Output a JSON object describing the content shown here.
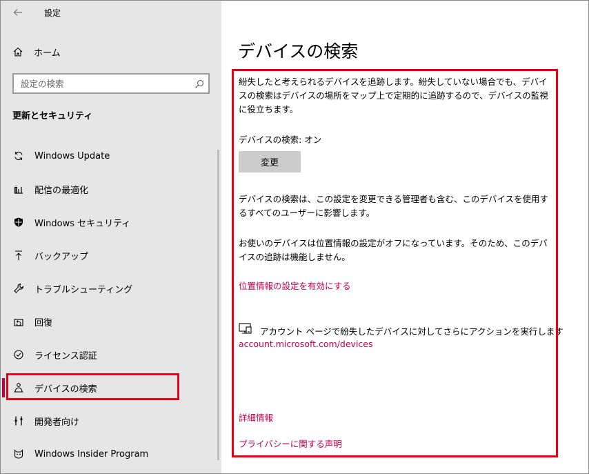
{
  "window": {
    "title": "設定"
  },
  "sidebar": {
    "home_label": "ホーム",
    "search_placeholder": "設定の検索",
    "section_title": "更新とセキュリティ",
    "items": [
      {
        "label": "Windows Update",
        "icon": "sync-icon"
      },
      {
        "label": "配信の最適化",
        "icon": "delivery-optimization-icon"
      },
      {
        "label": "Windows セキュリティ",
        "icon": "shield-icon"
      },
      {
        "label": "バックアップ",
        "icon": "backup-arrow-icon"
      },
      {
        "label": "トラブルシューティング",
        "icon": "wrench-icon"
      },
      {
        "label": "回復",
        "icon": "recovery-icon"
      },
      {
        "label": "ライセンス認証",
        "icon": "check-circle-icon"
      },
      {
        "label": "デバイスの検索",
        "icon": "person-location-icon",
        "selected": true
      },
      {
        "label": "開発者向け",
        "icon": "developer-tools-icon"
      },
      {
        "label": "Windows Insider Program",
        "icon": "insider-cat-icon"
      }
    ]
  },
  "main": {
    "title": "デバイスの検索",
    "description": "紛失したと考えられるデバイスを追跡します。紛失していない場合でも、デバイスの検索はデバイスの場所をマップ上で定期的に追跡するので、デバイスの監視に役立ちます。",
    "status_text": "デバイスの検索: オン",
    "change_button": "変更",
    "admin_note": "デバイスの検索は、この設定を変更できる管理者も含む、このデバイスを使用するすべてのユーザーに影響します。",
    "location_off_note": "お使いのデバイスは位置情報の設定がオフになっています。そのため、このデバイスの追跡は機能しません。",
    "enable_location_link": "位置情報の設定を有効にする",
    "account_text": "アカウント ページで紛失したデバイスに対してさらにアクションを実行します",
    "account_link": "account.microsoft.com/devices",
    "more_info_link": "詳細情報",
    "privacy_link": "プライバシーに関する声明"
  },
  "colors": {
    "sidebar_bg": "#e6e6e6",
    "accent": "#c3004d",
    "highlight_box": "#e60012",
    "button_bg": "#cccccc"
  }
}
